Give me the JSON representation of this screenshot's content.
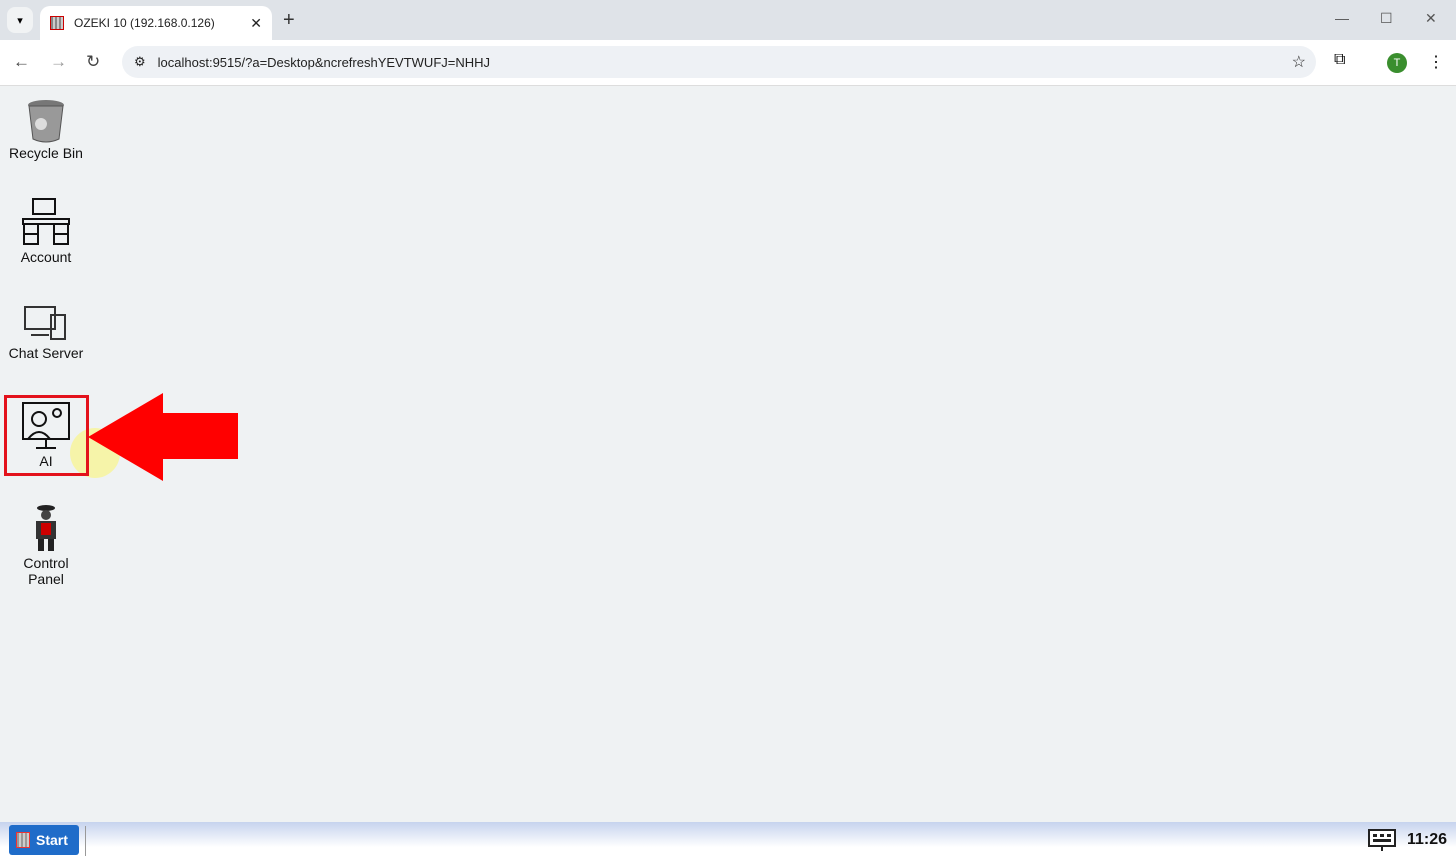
{
  "browser": {
    "tab_title": "OZEKI 10 (192.168.0.126)",
    "url": "localhost:9515/?a=Desktop&ncrefreshYEVTWUFJ=NHHJ",
    "profile_initial": "T"
  },
  "desktop": {
    "icons": [
      {
        "label": "Recycle Bin"
      },
      {
        "label": "Account"
      },
      {
        "label": "Chat Server"
      },
      {
        "label": "AI"
      },
      {
        "label": "Control Panel"
      }
    ],
    "highlight_color": "#e3121b"
  },
  "taskbar": {
    "start_label": "Start",
    "clock": "11:26"
  }
}
